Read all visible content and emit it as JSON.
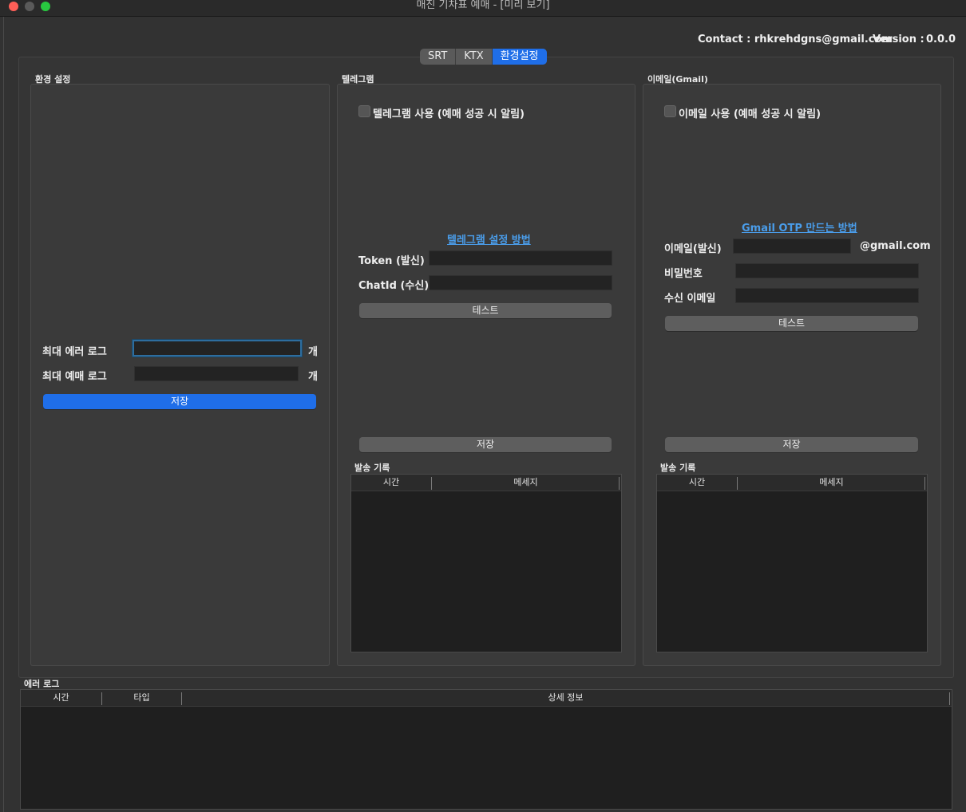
{
  "window": {
    "title": "매진 기차표 예매 - [미리 보기]"
  },
  "header": {
    "contact": "Contact : rhkrehdgns@gmail.com",
    "version_label": "Version :",
    "version_value": "0.0.0"
  },
  "tabs": [
    {
      "label": "SRT",
      "active": false
    },
    {
      "label": "KTX",
      "active": false
    },
    {
      "label": "환경설정",
      "active": true
    }
  ],
  "settings": {
    "title": "환경 설정",
    "max_error_log_label": "최대 에러 로그",
    "max_error_log_value": "",
    "max_booking_log_label": "최대 예매 로그",
    "max_booking_log_value": "",
    "unit": "개",
    "save_label": "저장"
  },
  "telegram": {
    "title": "텔레그램",
    "enable_label": "텔레그램 사용 (예매 성공 시 알림)",
    "help_link": "텔레그램 설정 방법",
    "token_label": "Token (발신)",
    "chatid_label": "ChatId (수신)",
    "test_label": "테스트",
    "save_label": "저장",
    "history_title": "발송 기록",
    "history_columns": [
      "시간",
      "메세지"
    ]
  },
  "email": {
    "title": "이메일(Gmail)",
    "enable_label": "이메일 사용 (예매 성공 시 알림)",
    "help_link": "Gmail OTP 만드는 방법",
    "sender_label": "이메일(발신)",
    "domain_suffix": "@gmail.com",
    "password_label": "비밀번호",
    "receiver_label": "수신 이메일",
    "test_label": "테스트",
    "save_label": "저장",
    "history_title": "발송 기록",
    "history_columns": [
      "시간",
      "메세지"
    ]
  },
  "error_log": {
    "title": "에러 로그",
    "columns": [
      "시간",
      "타입",
      "상세 정보"
    ]
  },
  "colors": {
    "accent": "#1f6ee8",
    "link": "#4a9dea",
    "background": "#323232"
  }
}
